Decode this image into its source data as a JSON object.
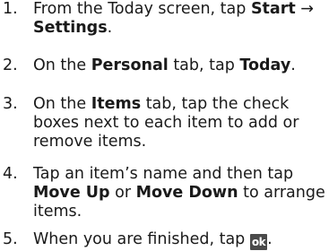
{
  "steps": [
    {
      "number": "1.",
      "line1_a": "From the Today screen, tap ",
      "line1_b": "Start",
      "line1_c": " →",
      "line2_a": "Settings",
      "line2_b": "."
    },
    {
      "number": "2.",
      "a": "On the ",
      "b": "Personal",
      "c": " tab, tap ",
      "d": "Today",
      "e": "."
    },
    {
      "number": "3.",
      "line1_a": "On the ",
      "line1_b": "Items",
      "line1_c": " tab, tap the check",
      "line2": "boxes next to each item to add or",
      "line3": "remove items."
    },
    {
      "number": "4.",
      "line1": "Tap an item’s name and then tap",
      "line2_a": "Move Up",
      "line2_b": " or ",
      "line2_c": "Move Down",
      "line2_d": " to arrange",
      "line3": "items."
    },
    {
      "number": "5.",
      "a": "When you are finished, tap ",
      "button": "ok",
      "b": "."
    }
  ]
}
